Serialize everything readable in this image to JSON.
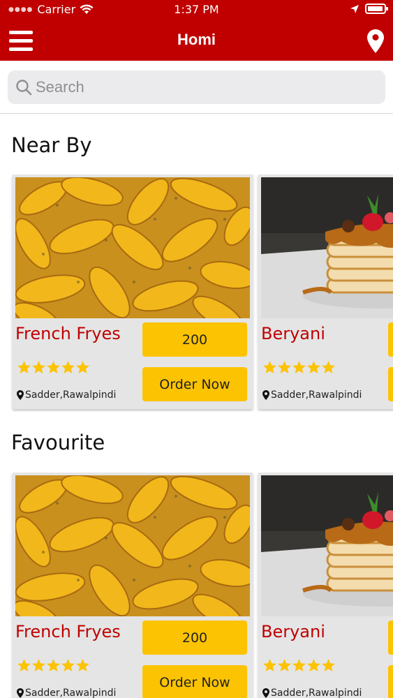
{
  "status_bar": {
    "carrier": "Carrier",
    "time": "1:37 PM"
  },
  "header": {
    "title": "Homi",
    "bg_color": "#c00000"
  },
  "search": {
    "placeholder": "Search"
  },
  "sections": [
    {
      "title": "Near By",
      "cards": [
        {
          "name": "French Fryes",
          "price": "200",
          "button": "Order Now",
          "location": "Sadder,Rawalpindi",
          "rating": 5,
          "image": "fries"
        },
        {
          "name": "Beryani",
          "price": "",
          "button": "",
          "location": "Sadder,Rawalpindi",
          "rating": 5,
          "image": "pancakes"
        }
      ]
    },
    {
      "title": "Favourite",
      "cards": [
        {
          "name": "French Fryes",
          "price": "200",
          "button": "Order Now",
          "location": "Sadder,Rawalpindi",
          "rating": 5,
          "image": "fries"
        },
        {
          "name": "Beryani",
          "price": "",
          "button": "",
          "location": "Sadder,Rawalpindi",
          "rating": 5,
          "image": "pancakes"
        }
      ]
    }
  ],
  "colors": {
    "accent": "#c00000",
    "button": "#fcc303",
    "star": "#fcc303",
    "card_bg": "#e5e5e5"
  }
}
